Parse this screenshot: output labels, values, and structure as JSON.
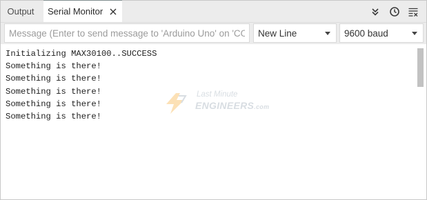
{
  "tabs": {
    "output_label": "Output",
    "serial_label": "Serial Monitor"
  },
  "toolbar_icons": {
    "toggle_autoscroll": "double-chevron-down-icon",
    "toggle_timestamp": "clock-icon",
    "clear_output": "clear-output-icon"
  },
  "message": {
    "value": "",
    "placeholder": "Message (Enter to send message to 'Arduino Uno' on 'CO…"
  },
  "line_ending": {
    "selected": "New Line"
  },
  "baud": {
    "selected": "9600 baud"
  },
  "output": {
    "lines": [
      "Initializing MAX30100..SUCCESS",
      "Something is there!",
      "Something is there!",
      "Something is there!",
      "Something is there!",
      "Something is there!"
    ]
  },
  "watermark": {
    "line1": "Last Minute",
    "line2": "ENGINEERS",
    "suffix": ".com"
  },
  "colors": {
    "chrome_bg": "#ececec",
    "active_tab_border": "#7f8c8d",
    "watermark_orange": "#f5b041",
    "watermark_gray": "#b9c3cc"
  }
}
